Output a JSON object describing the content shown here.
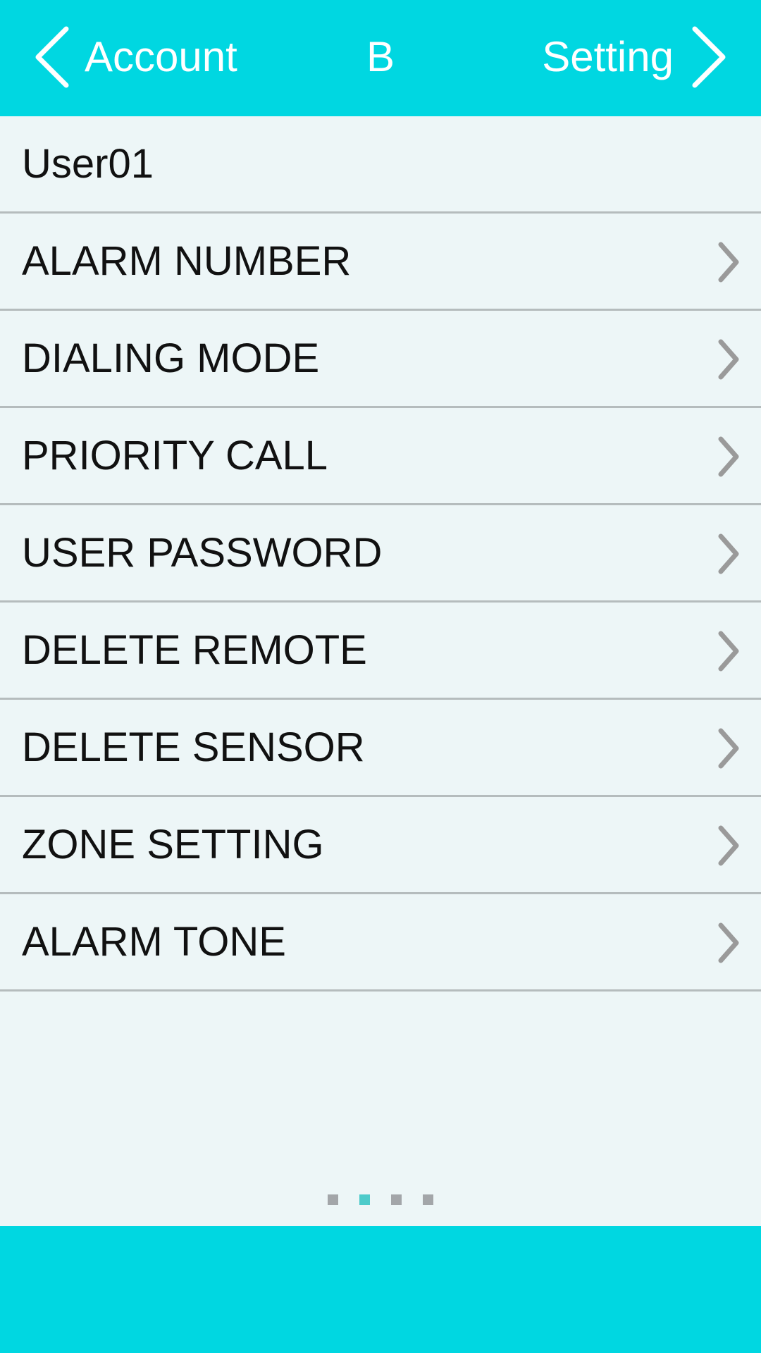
{
  "header": {
    "back_label": "Account",
    "title": "B",
    "forward_label": "Setting",
    "back_icon": "chevron-left-icon",
    "forward_icon": "chevron-right-icon"
  },
  "user": {
    "name": "User01"
  },
  "menu": {
    "items": [
      {
        "label": "ALARM NUMBER",
        "icon": "chevron-right-icon"
      },
      {
        "label": "DIALING MODE",
        "icon": "chevron-right-icon"
      },
      {
        "label": "PRIORITY CALL",
        "icon": "chevron-right-icon"
      },
      {
        "label": "USER PASSWORD",
        "icon": "chevron-right-icon"
      },
      {
        "label": "DELETE REMOTE",
        "icon": "chevron-right-icon"
      },
      {
        "label": "DELETE SENSOR",
        "icon": "chevron-right-icon"
      },
      {
        "label": "ZONE SETTING",
        "icon": "chevron-right-icon"
      },
      {
        "label": "ALARM TONE",
        "icon": "chevron-right-icon"
      }
    ]
  },
  "pager": {
    "total_pages": 4,
    "current_page": 2
  },
  "colors": {
    "accent": "#00D7E1",
    "background": "#EDF6F7",
    "divider": "#B5BCBD",
    "page_dot": "#A3A6A9",
    "page_dot_active": "#4DCBCA"
  }
}
